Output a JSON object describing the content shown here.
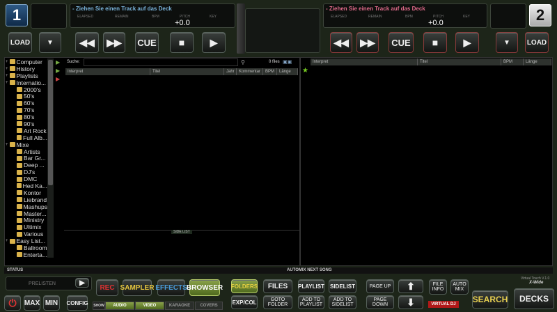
{
  "deck_left": {
    "number": "1",
    "message": "- Ziehen Sie einen Track auf das Deck",
    "labels": [
      "ELAPSED",
      "REMAIN",
      "BPM",
      "PITCH",
      "KEY"
    ],
    "pitch": "+0.0",
    "load": "LOAD",
    "cue": "CUE"
  },
  "deck_right": {
    "number": "2",
    "message": "- Ziehen Sie einen Track auf das Deck",
    "labels": [
      "ELAPSED",
      "REMAIN",
      "BPM",
      "PITCH",
      "KEY"
    ],
    "pitch": "+0.0",
    "load": "LOAD",
    "cue": "CUE"
  },
  "tree": [
    "Computer",
    "History",
    "Playlists",
    "Internatio...",
    "2000's",
    "50's",
    "60's",
    "70's",
    "80's",
    "90's",
    "Art Rock",
    "Full Alb...",
    "Mixe",
    "Artists",
    "Bar Gr...",
    "Deep ...",
    "DJ's",
    "DMC",
    "Hed Ka...",
    "Kontor",
    "Liebrand",
    "Mashups",
    "Master...",
    "Ministry",
    "Ultimix",
    "Various",
    "Easy List...",
    "Ballroom",
    "Enterta..."
  ],
  "search": {
    "label": "Suche:",
    "value": "",
    "files": "0 files"
  },
  "list_columns": [
    "Interpret",
    "Titel",
    "Jahr",
    "Kommentar",
    "BPM",
    "Länge"
  ],
  "side_columns": [
    "Interpret",
    "Titel",
    "BPM",
    "Länge"
  ],
  "side_list_label": "SIDE LIST",
  "status": {
    "label": "STATUS",
    "automix": "AUTOMIX NEXT SONG"
  },
  "bottom": {
    "prelisten": "PRELISTEN",
    "max": "MAX",
    "min": "MIN",
    "config": "CONFIG",
    "rec": "REC",
    "sampler": "SAMPLER",
    "effects": "EFFECTS",
    "browser": "BROWSER",
    "show": "SHOW",
    "audio": "AUDIO",
    "video": "VIDEO",
    "karaoke": "KARAOKE",
    "covers": "COVERS",
    "folders": "FOLDERS",
    "files": "FILES",
    "playlist": "PLAYLIST",
    "sidelist": "SIDELIST",
    "expcol": "EXP/COL",
    "goto": "GOTO FOLDER",
    "add_playlist": "ADD TO PLAYLIST",
    "add_sidelist": "ADD TO SIDELIST",
    "page_up": "PAGE UP",
    "page_down": "PAGE DOWN",
    "file_info": "FILE INFO",
    "auto_mix": "AUTO MIX",
    "search": "SEARCH",
    "decks": "DECKS",
    "version": "Virtual Touch V.1.0",
    "xwide": "X-Wide",
    "logo": "VIRTUALDJ"
  }
}
